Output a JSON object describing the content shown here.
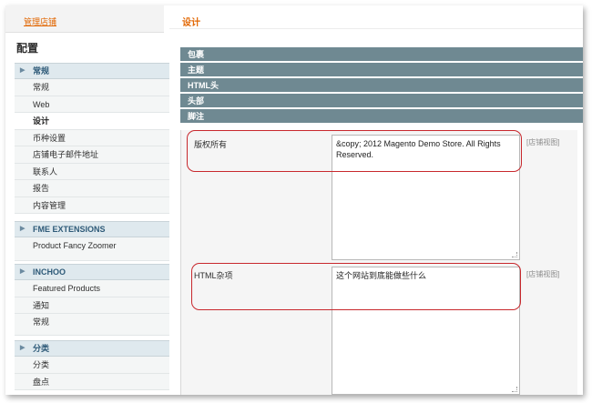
{
  "store_switch": {
    "label": "管理店铺"
  },
  "sidebar": {
    "title": "配置",
    "groups": [
      {
        "header": "常规",
        "items": [
          "常规",
          "Web",
          "设计",
          "币种设置",
          "店铺电子邮件地址",
          "联系人",
          "报告",
          "内容管理"
        ]
      },
      {
        "header": "FME EXTENSIONS",
        "items": [
          "Product Fancy Zoomer"
        ]
      },
      {
        "header": "INCHOO",
        "items": [
          "Featured Products",
          "通知",
          "常规"
        ]
      },
      {
        "header": "分类",
        "items": [
          "分类",
          "盘点"
        ]
      }
    ],
    "active_item": "设计"
  },
  "main": {
    "title": "设计",
    "sections": [
      "包裹",
      "主题",
      "HTML头",
      "头部",
      "脚注"
    ],
    "fields": [
      {
        "label": "版权所有",
        "value": "&copy; 2012 Magento Demo Store. All Rights Reserved.",
        "scope": "[店铺视图]"
      },
      {
        "label": "HTML杂项",
        "value": "这个网站到底能做些什么",
        "scope": "[店铺视图]"
      }
    ]
  },
  "colors": {
    "accent": "#e26703",
    "section_bar": "#6f8992",
    "highlight": "#c8282d",
    "sidebar_header": "#2e5a78"
  }
}
